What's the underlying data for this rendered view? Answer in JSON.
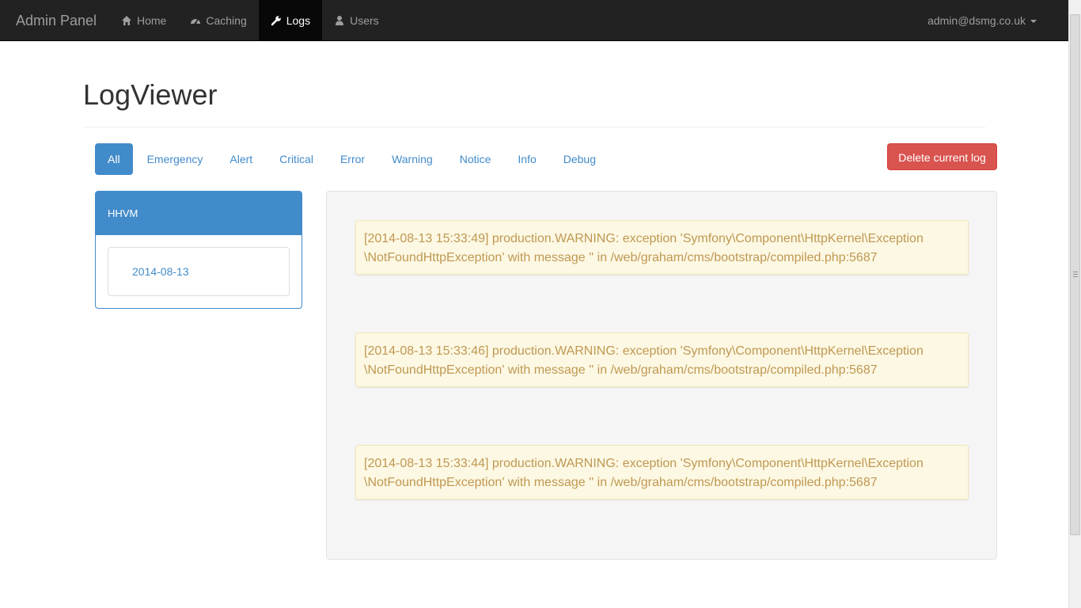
{
  "navbar": {
    "brand": "Admin Panel",
    "items": [
      {
        "label": "Home",
        "icon": "home-icon",
        "active": false
      },
      {
        "label": "Caching",
        "icon": "dashboard-icon",
        "active": false
      },
      {
        "label": "Logs",
        "icon": "wrench-icon",
        "active": true
      },
      {
        "label": "Users",
        "icon": "user-icon",
        "active": false
      }
    ],
    "user": "admin@dsmg.co.uk"
  },
  "page": {
    "title": "LogViewer"
  },
  "filters": {
    "tabs": [
      "All",
      "Emergency",
      "Alert",
      "Critical",
      "Error",
      "Warning",
      "Notice",
      "Info",
      "Debug"
    ],
    "active": "All"
  },
  "actions": {
    "delete_label": "Delete current log"
  },
  "sidebar": {
    "heading": "HHVM",
    "logs": [
      "2014-08-13"
    ]
  },
  "entries": [
    {
      "line1": "[2014-08-13 15:33:49] production.WARNING: exception 'Symfony\\Component\\HttpKernel\\Exception",
      "line2": "\\NotFoundHttpException' with message '' in /web/graham/cms/bootstrap/compiled.php:5687"
    },
    {
      "line1": "[2014-08-13 15:33:46] production.WARNING: exception 'Symfony\\Component\\HttpKernel\\Exception",
      "line2": "\\NotFoundHttpException' with message '' in /web/graham/cms/bootstrap/compiled.php:5687"
    },
    {
      "line1": "[2014-08-13 15:33:44] production.WARNING: exception 'Symfony\\Component\\HttpKernel\\Exception",
      "line2": "\\NotFoundHttpException' with message '' in /web/graham/cms/bootstrap/compiled.php:5687"
    }
  ],
  "colors": {
    "navbar_bg": "#222222",
    "primary": "#428bca",
    "danger": "#d9534f",
    "warning_bg": "#fcf8e3",
    "warning_text": "#c09853"
  }
}
